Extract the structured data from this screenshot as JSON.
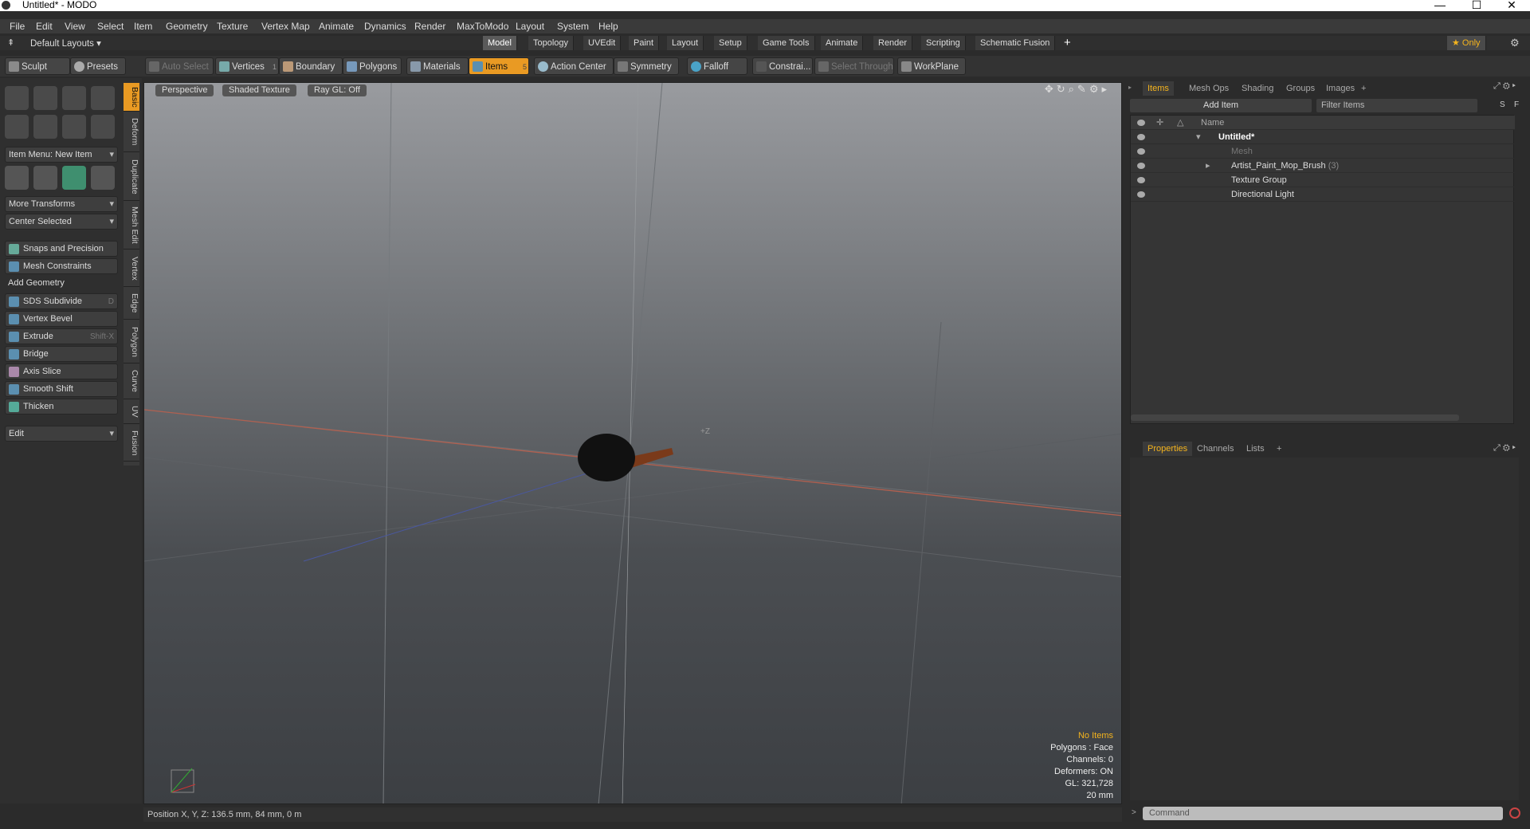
{
  "window": {
    "title": "Untitled* - MODO",
    "min": "—",
    "max": "☐",
    "close": "✕"
  },
  "menu": [
    "File",
    "Edit",
    "View",
    "Select",
    "Item",
    "Geometry",
    "Texture",
    "Vertex Map",
    "Animate",
    "Dynamics",
    "Render",
    "MaxToModo",
    "Layout",
    "System",
    "Help"
  ],
  "layouts": {
    "preset": "Default Layouts ▾",
    "only_label": "★ Only",
    "tabs": [
      "Model",
      "Topology",
      "UVEdit",
      "Paint",
      "Layout",
      "Setup",
      "Game Tools",
      "Animate",
      "Render",
      "Scripting",
      "Schematic Fusion"
    ],
    "active": "Model"
  },
  "toolbar": {
    "sculpt": "Sculpt",
    "presets": "Presets",
    "items": [
      "Auto Select",
      "Vertices",
      "Boundary",
      "Polygons",
      "Materials",
      "Items",
      "Action Center",
      "Symmetry",
      "Falloff",
      "Constrai...",
      "Select Through",
      "WorkPlane"
    ],
    "vertices_badge": "1",
    "items_badge": "5"
  },
  "leftpanel": {
    "item_menu": "Item Menu: New Item",
    "more_transforms": "More Transforms",
    "center_selected": "Center Selected",
    "snaps": "Snaps and Precision",
    "mesh_constraints": "Mesh Constraints",
    "add_geometry": "Add Geometry",
    "tools": [
      {
        "label": "SDS Subdivide",
        "shortcut": "D"
      },
      {
        "label": "Vertex Bevel",
        "shortcut": ""
      },
      {
        "label": "Extrude",
        "shortcut": "Shift-X"
      },
      {
        "label": "Bridge",
        "shortcut": ""
      },
      {
        "label": "Axis Slice",
        "shortcut": ""
      },
      {
        "label": "Smooth Shift",
        "shortcut": ""
      },
      {
        "label": "Thicken",
        "shortcut": ""
      }
    ],
    "edit": "Edit",
    "vtabs": [
      "Basic",
      "Deform",
      "Duplicate",
      "Mesh Edit",
      "Vertex",
      "Edge",
      "Polygon",
      "Curve",
      "UV",
      "Fusion"
    ]
  },
  "viewport": {
    "view": "Perspective",
    "shading": "Shaded Texture",
    "raygl": "Ray GL: Off",
    "axis_label": "+Z",
    "stats": {
      "no_items": "No Items",
      "polygons": "Polygons : Face",
      "channels": "Channels: 0",
      "deformers": "Deformers: ON",
      "gl": "GL: 321,728",
      "scale": "20 mm"
    }
  },
  "status": "Position X, Y, Z:  136.5 mm, 84 mm, 0 m",
  "itemspanel": {
    "tabs": [
      "Items",
      "Mesh Ops",
      "Shading",
      "Groups",
      "Images",
      "+"
    ],
    "add_item": "Add Item",
    "filter_placeholder": "Filter Items",
    "s": "S",
    "f": "F",
    "col_name": "Name",
    "rows": [
      {
        "name": "Untitled*",
        "suffix": ""
      },
      {
        "name": "Mesh",
        "suffix": ""
      },
      {
        "name": "Artist_Paint_Mop_Brush",
        "suffix": "(3)"
      },
      {
        "name": "Texture Group",
        "suffix": ""
      },
      {
        "name": "Directional Light",
        "suffix": ""
      }
    ]
  },
  "propspanel": {
    "tabs": [
      "Properties",
      "Channels",
      "Lists",
      "+"
    ]
  },
  "command": {
    "placeholder": "Command"
  },
  "colors": {
    "accent": "#e99a23",
    "highlight": "#f5b41d"
  }
}
